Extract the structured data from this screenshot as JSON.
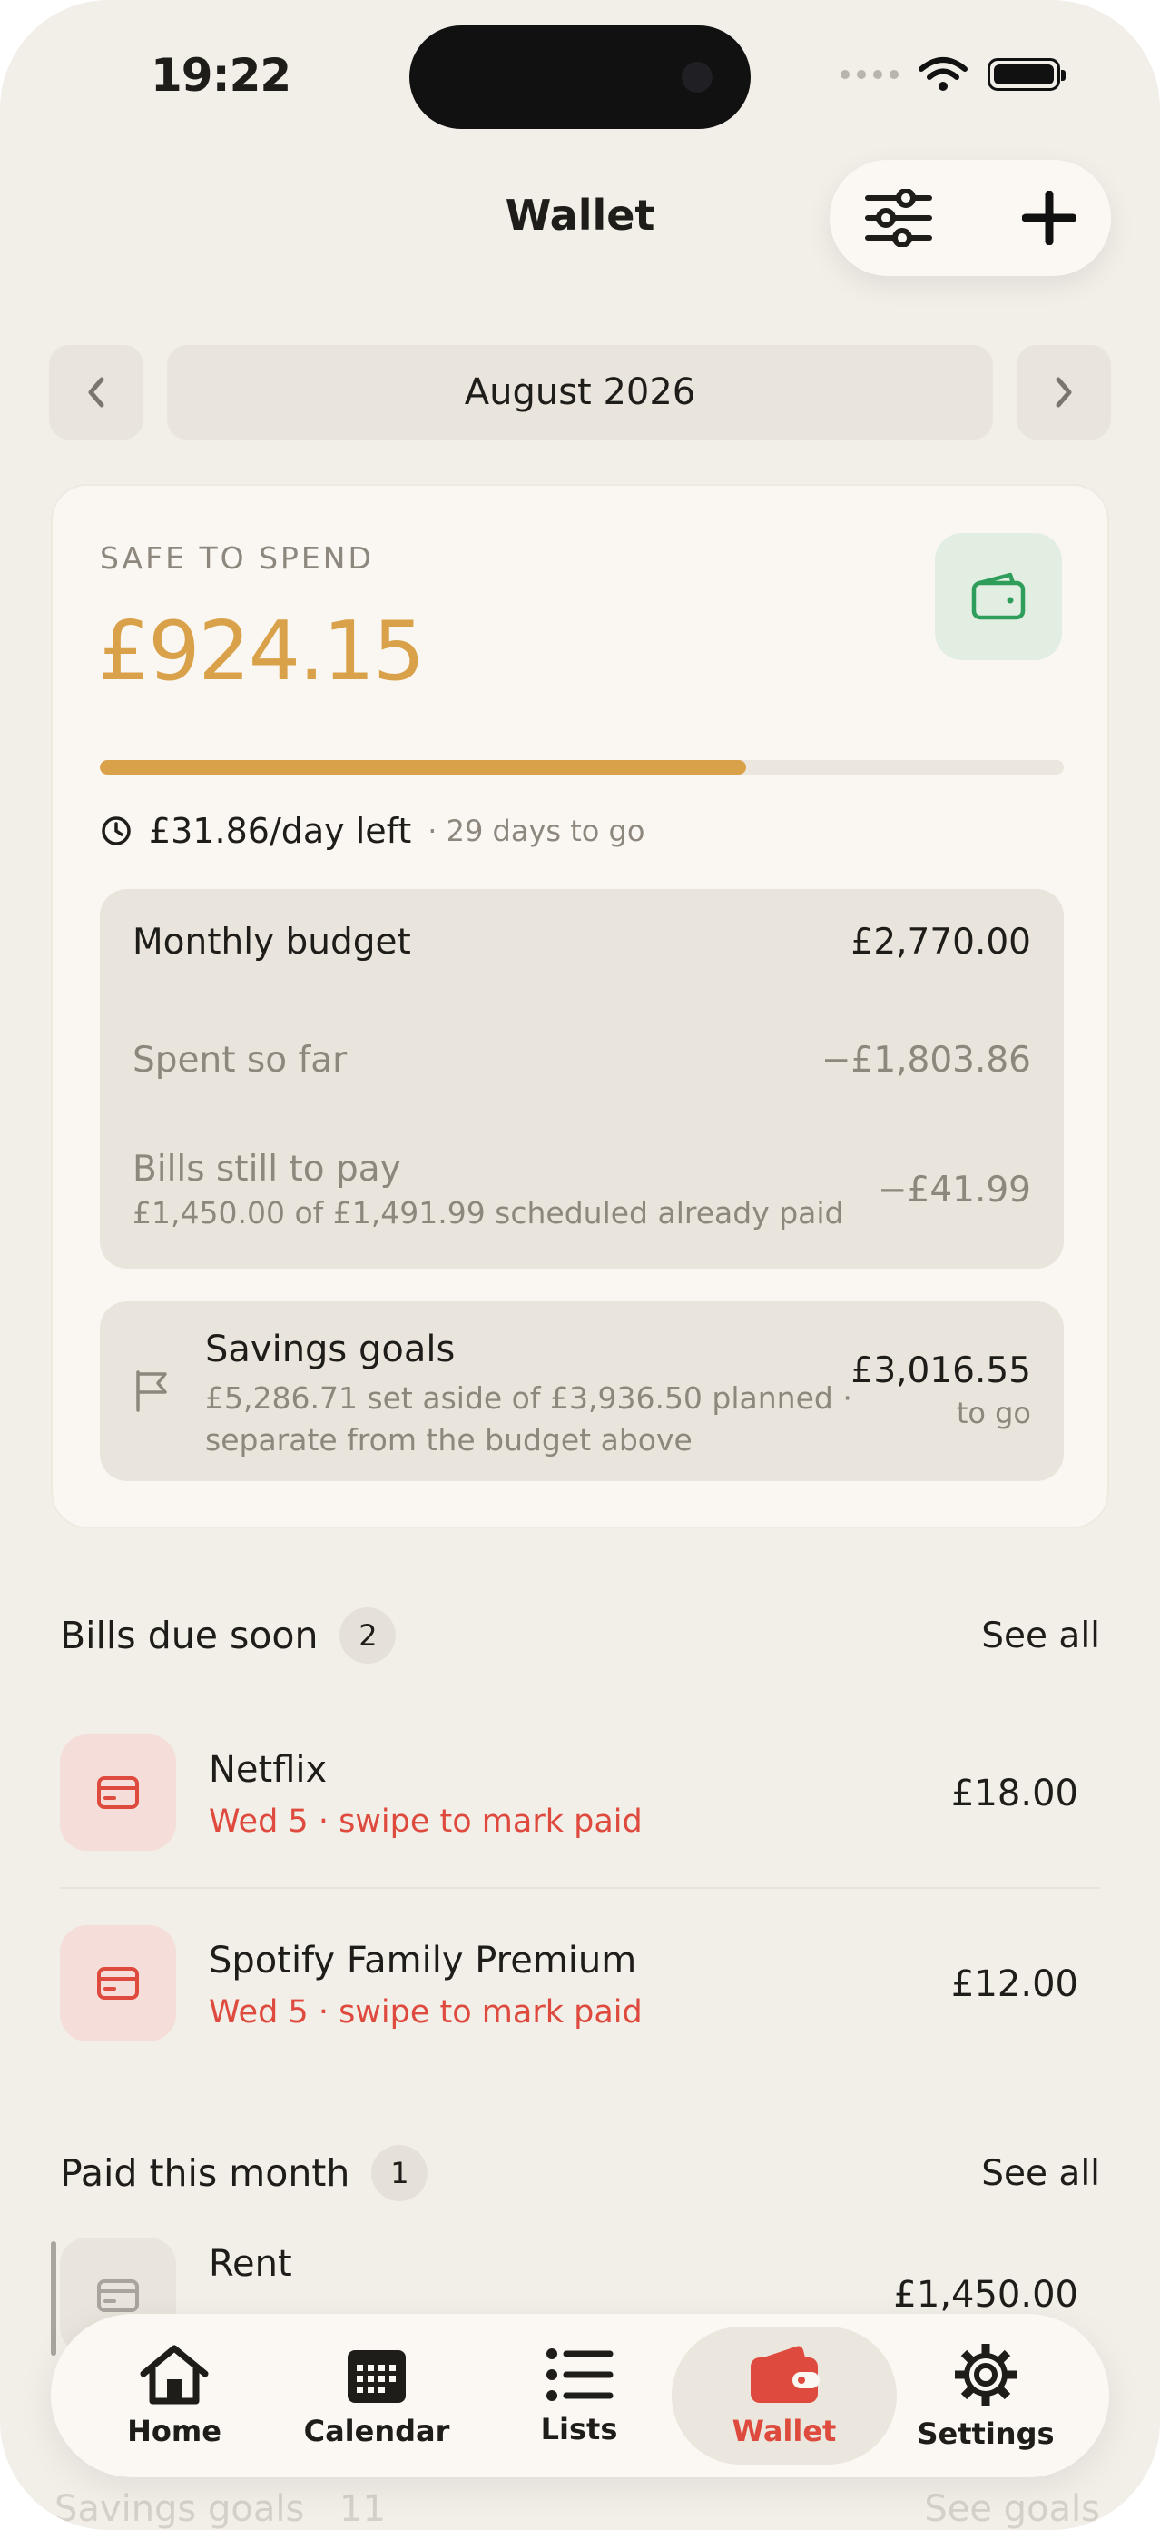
{
  "status": {
    "time": "19:22"
  },
  "header": {
    "title": "Wallet"
  },
  "month": {
    "label": "August 2026"
  },
  "summary": {
    "safe_label": "SAFE TO SPEND",
    "safe_amount": "£924.15",
    "progress_fraction": 0.67,
    "per_day": "£31.86/day left",
    "days_to_go": "· 29 days to go",
    "budget_label": "Monthly budget",
    "budget_value": "£2,770.00",
    "spent_label": "Spent so far",
    "spent_value": "−£1,803.86",
    "bills_label": "Bills still to pay",
    "bills_sub": "£1,450.00 of £1,491.99 scheduled already paid",
    "bills_value": "−£41.99"
  },
  "goals": {
    "title": "Savings goals",
    "subtitle": "£5,286.71 set aside of £3,936.50 planned · separate from the budget above",
    "amount": "£3,016.55",
    "to_go": "to go"
  },
  "bills_due": {
    "title": "Bills due soon",
    "count": "2",
    "see_all": "See all",
    "items": [
      {
        "name": "Netflix",
        "due": "Wed 5 · swipe to mark paid",
        "amount": "£18.00"
      },
      {
        "name": "Spotify Family Premium",
        "due": "Wed 5 · swipe to mark paid",
        "amount": "£12.00"
      }
    ]
  },
  "paid": {
    "title": "Paid this month",
    "count": "1",
    "see_all": "See all",
    "items": [
      {
        "name": "Rent",
        "amount": "£1,450.00"
      }
    ]
  },
  "below": {
    "title": "Savings goals",
    "count": "11",
    "see_all": "See goals"
  },
  "tabs": [
    {
      "label": "Home",
      "icon": "home-icon"
    },
    {
      "label": "Calendar",
      "icon": "calendar-icon"
    },
    {
      "label": "Lists",
      "icon": "list-icon"
    },
    {
      "label": "Wallet",
      "icon": "wallet-icon",
      "active": true
    },
    {
      "label": "Settings",
      "icon": "gear-icon"
    }
  ],
  "colors": {
    "accent": "#d9a24a",
    "danger": "#de4b3e",
    "success": "#2f9e5a",
    "background": "#f2eee8"
  }
}
